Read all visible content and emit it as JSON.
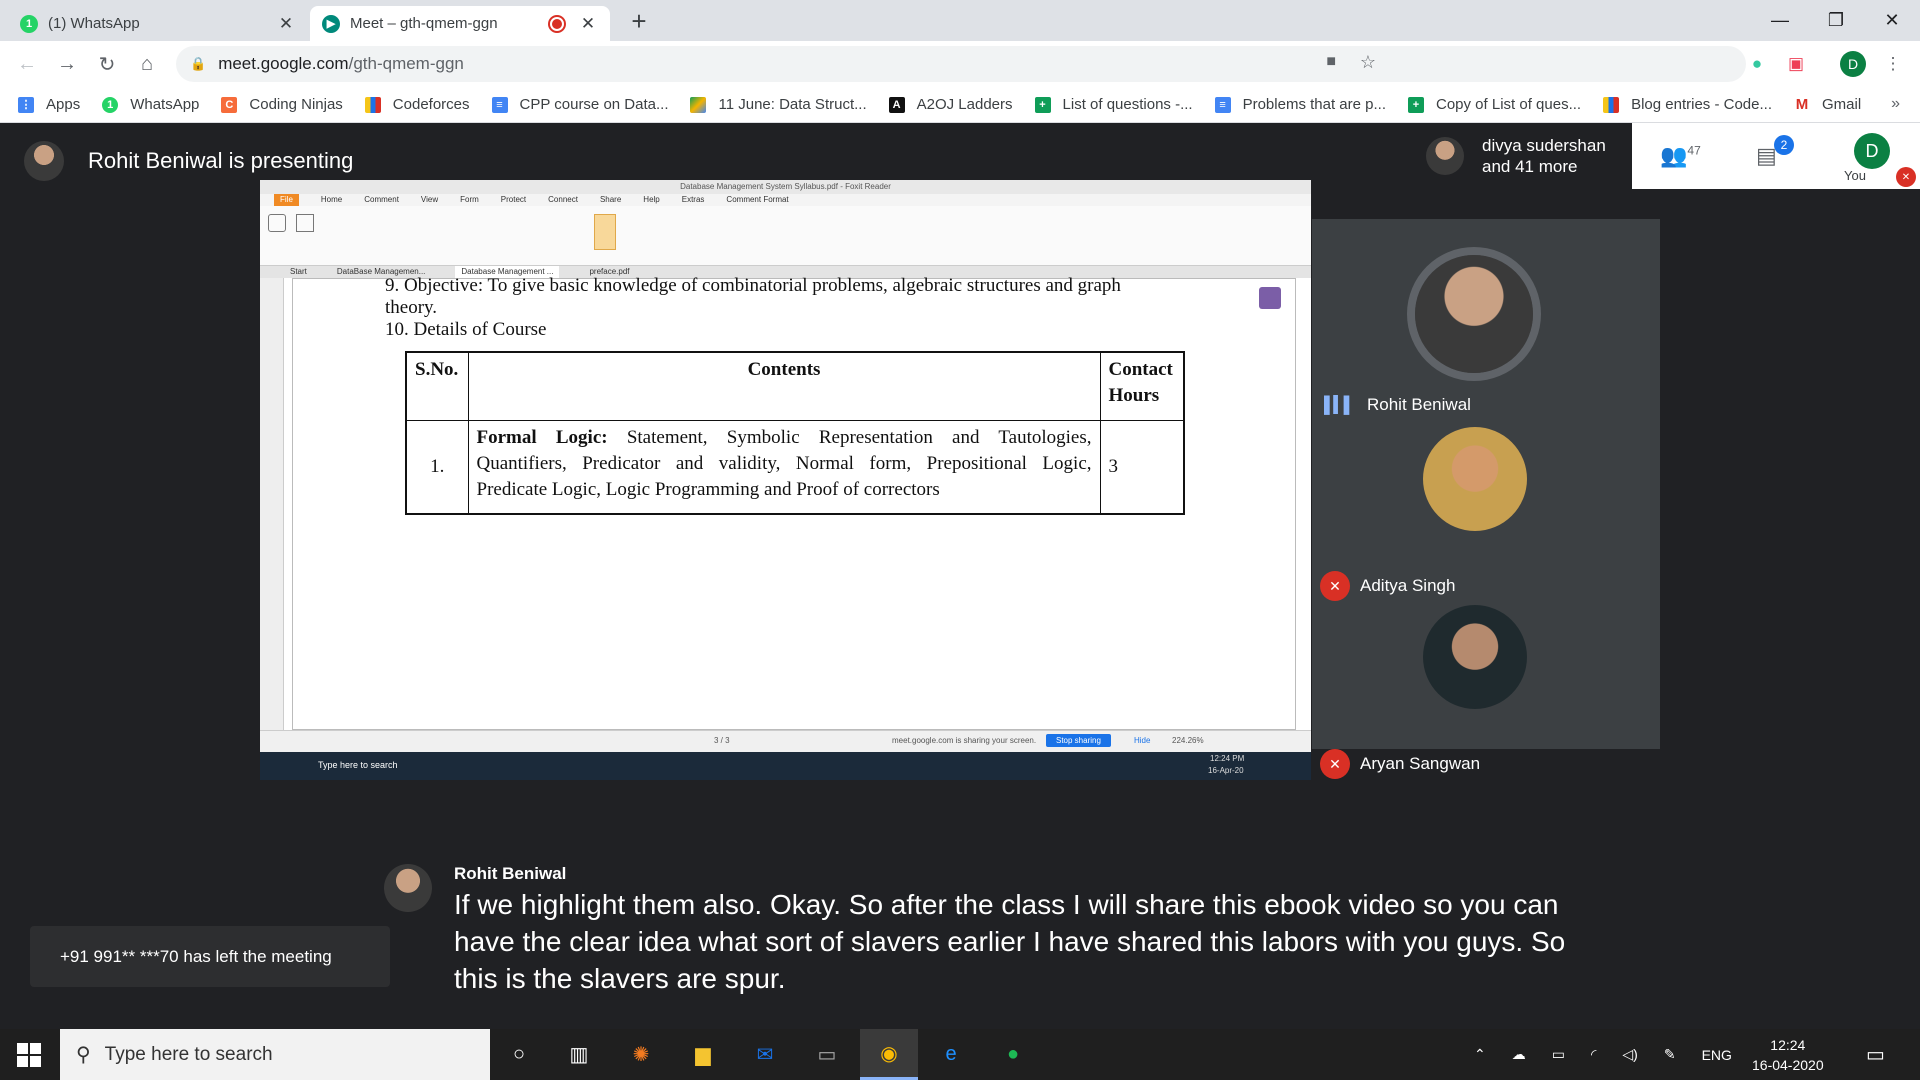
{
  "browser": {
    "tabs": [
      {
        "title": "(1) WhatsApp",
        "active": false
      },
      {
        "title": "Meet – gth-qmem-ggn",
        "active": true
      }
    ],
    "url_host": "meet.google.com",
    "url_path": "/gth-qmem-ggn",
    "profile_initial": "D",
    "bookmarks": [
      "Apps",
      "WhatsApp",
      "Coding Ninjas",
      "Codeforces",
      "CPP course on Data...",
      "11 June: Data Struct...",
      "A2OJ Ladders",
      "List of questions -...",
      "Problems that are p...",
      "Copy of List of ques...",
      "Blog entries - Code...",
      "Gmail"
    ]
  },
  "meet": {
    "presenting_label": "Rohit Beniwal is presenting",
    "participants_summary_1": "divya sudershan",
    "participants_summary_2": "and 41 more",
    "people_count": "47",
    "chat_count": "2",
    "you_label": "You",
    "you_initial": "D",
    "participants": [
      {
        "name": "Rohit Beniwal",
        "speaking": true
      },
      {
        "name": "Aditya Singh",
        "muted": true
      },
      {
        "name": "Aryan Sangwan",
        "muted": true
      }
    ],
    "caption_speaker": "Rohit Beniwal",
    "caption_text": "If we highlight them also. Okay. So after the class I will share this ebook video so you can have the clear idea what sort of slavers earlier I have shared this labors with you guys. So this is the slavers are spur.",
    "toast": "+91 991** ***70 has left the meeting"
  },
  "shared_screen": {
    "window_title": "Database Management System Syllabus.pdf - Foxit Reader",
    "menu": [
      "File",
      "Home",
      "Comment",
      "View",
      "Form",
      "Protect",
      "Connect",
      "Share",
      "Help",
      "Extras",
      "Comment Format"
    ],
    "doc_tabs": [
      "Start",
      "DataBase Managemen...",
      "Database Management ...",
      "preface.pdf"
    ],
    "line_objective_1": "9. Objective: To give basic knowledge of combinatorial problems, algebraic structures and graph",
    "line_objective_2": "theory.",
    "line_details": "10. Details of Course",
    "table_headers": [
      "S.No.",
      "Contents",
      "Contact Hours"
    ],
    "row_sno": "1.",
    "row_bold": "Formal Logic:",
    "row_contents": "Statement, Symbolic Representation and Tautologies, Quantifiers, Predicator and validity, Normal form, Prepositional Logic, Predicate Logic, Logic Programming and Proof of correctors",
    "row_hours": "3",
    "share_notice": "meet.google.com is sharing your screen.",
    "stop_sharing": "Stop sharing",
    "hide": "Hide",
    "zoom": "224.26%",
    "page_nav": "3 / 3",
    "inner_search": "Type here to search",
    "inner_time": "12:24 PM",
    "inner_date": "16-Apr-20"
  },
  "taskbar": {
    "search_placeholder": "Type here to search",
    "lang": "ENG",
    "time": "12:24",
    "date": "16-04-2020"
  },
  "colors": {
    "meet_bg": "#202124",
    "accent_green": "#1e8e3e",
    "mute_red": "#d93025",
    "speaking_blue": "#8ab4f8"
  }
}
